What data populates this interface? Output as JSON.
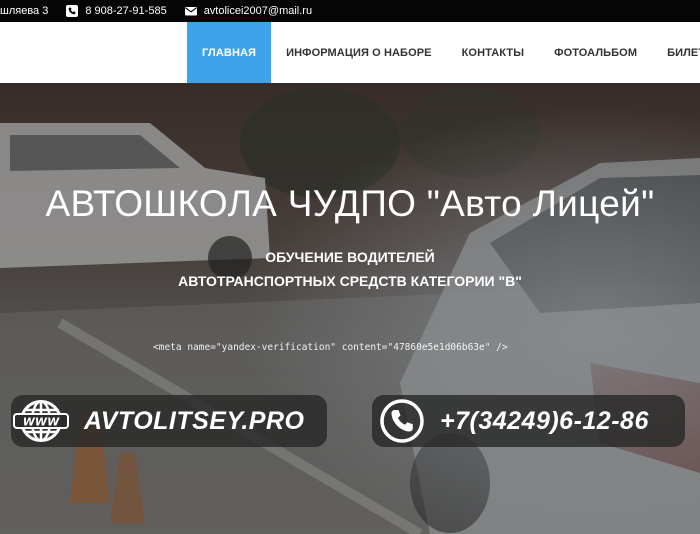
{
  "topbar": {
    "address": "шляева 3",
    "phone": "8 908-27-91-585",
    "email": "avtolicei2007@mail.ru"
  },
  "nav": {
    "items": [
      {
        "label": "ГЛАВНАЯ",
        "active": true
      },
      {
        "label": "ИНФОРМАЦИЯ О НАБОРЕ",
        "active": false
      },
      {
        "label": "КОНТАКТЫ",
        "active": false
      },
      {
        "label": "ФОТОАЛЬБОМ",
        "active": false
      },
      {
        "label": "БИЛЕТЫ ПД",
        "active": false
      }
    ]
  },
  "hero": {
    "title": "АВТОШКОЛА ЧУДПО \"Авто Лицей\"",
    "subtitle_line1": "ОБУЧЕНИЕ ВОДИТЕЛЕЙ",
    "subtitle_line2": "АВТОТРАНСПОРТНЫХ СРЕДСТВ КАТЕГОРИИ \"В\"",
    "meta_text": "<meta name=\"yandex-verification\" content=\"47860e5e1d06b63e\" />",
    "website": "AVTOLITSEY.PRO",
    "phone": "+7(34249)6-12-86"
  },
  "colors": {
    "accent": "#3ea4ea",
    "topbar_bg": "#050505",
    "nav_bg": "#ffffff"
  }
}
